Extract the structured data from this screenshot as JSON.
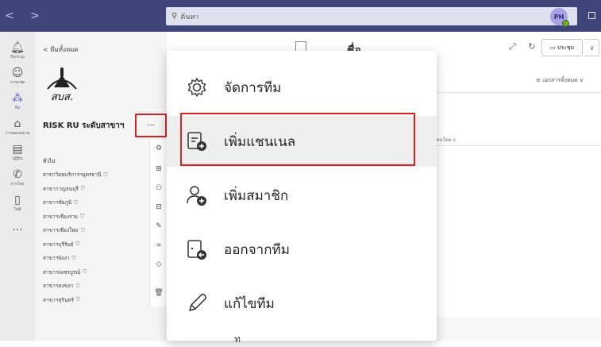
{
  "titlebar": {
    "search_placeholder": "ค้นหา",
    "avatar_initials": "PH",
    "nav_arrows": "< >",
    "minimize": "–"
  },
  "rail": {
    "items": [
      {
        "label": "กิจกรรม",
        "icon": "bell-icon"
      },
      {
        "label": "การแชท",
        "icon": "chat-icon"
      },
      {
        "label": "ทีม",
        "icon": "teams-icon"
      },
      {
        "label": "การมอบหมาย",
        "icon": "assignments-icon"
      },
      {
        "label": "ปฏิทิน",
        "icon": "calendar-icon"
      },
      {
        "label": "การโทร",
        "icon": "phone-icon"
      },
      {
        "label": "ไฟล์",
        "icon": "file-icon"
      },
      {
        "label": "...",
        "icon": "more-icon"
      }
    ]
  },
  "panel": {
    "back_label": "<  ทีมทั้งหมด",
    "logo_text": "สบส.",
    "team_name": "RISK RU ระดับสาขาฯ",
    "more_label": "···",
    "channels": [
      {
        "name": "ทั่วไป",
        "shield": ""
      },
      {
        "name": "สาขาวิทยบริการฯอุดรธานี",
        "shield": "⛉"
      },
      {
        "name": "สาขากาญจนบุรี",
        "shield": "⛉"
      },
      {
        "name": "สาขาฯชัยภูมิ",
        "shield": "⛉"
      },
      {
        "name": "สาขาฯเชียงราย",
        "shield": "⛉"
      },
      {
        "name": "สาขาฯเชียงใหม่",
        "shield": "⛉"
      },
      {
        "name": "สาขาฯบุรีรัมย์",
        "shield": "⛉"
      },
      {
        "name": "สาขาฯพังงา",
        "shield": "⛉"
      },
      {
        "name": "สาขาฯเพชรบูรณ์",
        "shield": "⛉"
      },
      {
        "name": "สาขาฯสงขลา",
        "shield": "⛉"
      },
      {
        "name": "สาขาฯสุรินทร์",
        "shield": "⛉"
      }
    ]
  },
  "main": {
    "ghost_title": "ชื่อ",
    "meet_label": "ประชุม",
    "all_docs_label": "≡  เอกสารทั้งหมด  ∨",
    "col_header": "ยนโดย ∨",
    "bottom_text": "ท"
  },
  "menu": {
    "items": [
      {
        "label": "จัดการทีม",
        "icon": "gear-icon"
      },
      {
        "label": "เพิ่มแชนเนล",
        "icon": "add-channel-icon"
      },
      {
        "label": "เพิ่มสมาชิก",
        "icon": "add-member-icon"
      },
      {
        "label": "ออกจากทีม",
        "icon": "leave-team-icon"
      },
      {
        "label": "แก้ไขทีม",
        "icon": "pencil-icon"
      }
    ]
  },
  "colors": {
    "titlebar": "#3f4579",
    "accent": "#5b5fc7",
    "highlight": "#e02020"
  }
}
